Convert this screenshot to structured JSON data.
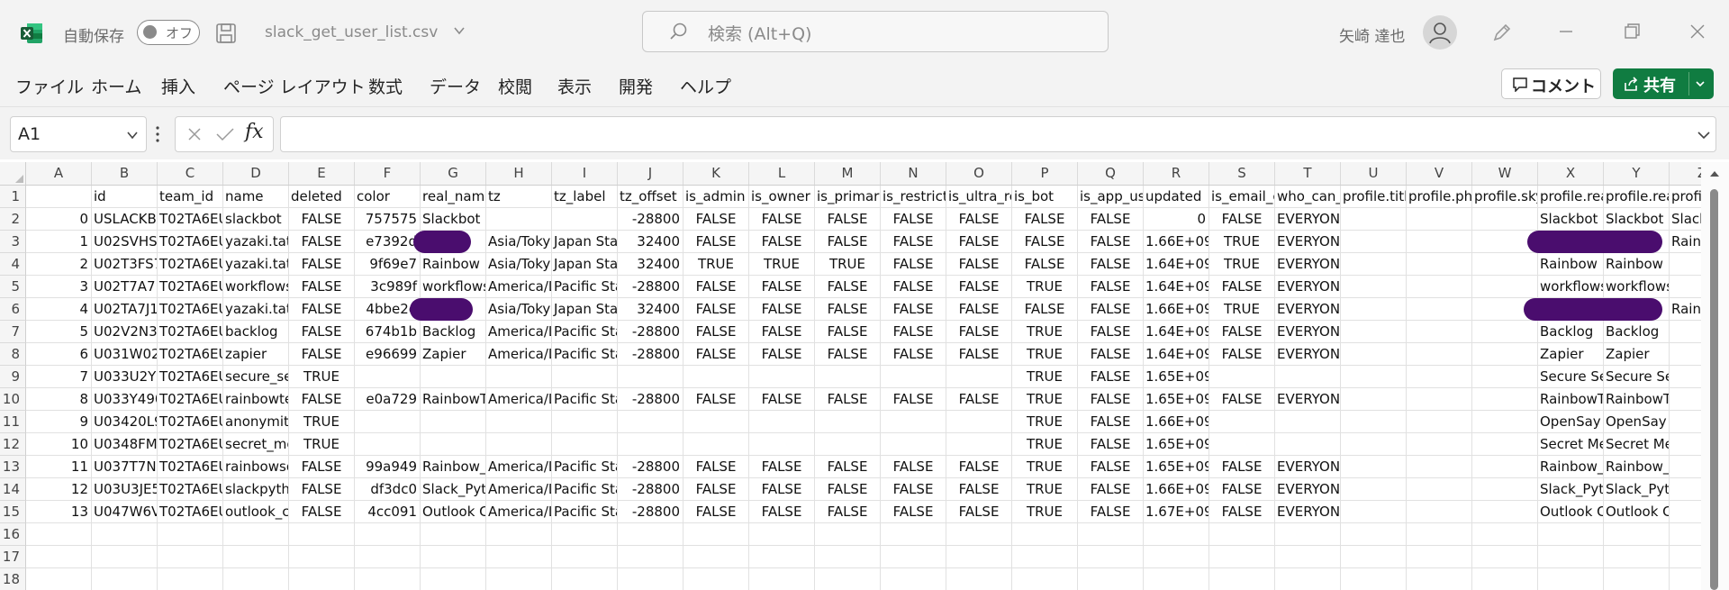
{
  "titlebar": {
    "autosave_label": "自動保存",
    "autosave_state": "オフ",
    "file_name": "slack_get_user_list.csv",
    "search_placeholder": "検索 (Alt+Q)",
    "user_name": "矢崎 達也",
    "icons": [
      "excel-logo-icon",
      "save-icon",
      "chevron-down-icon",
      "search-icon",
      "user-avatar-icon",
      "pen-icon",
      "minimize-icon",
      "restore-icon",
      "close-icon"
    ]
  },
  "menu": {
    "items": [
      "ファイル",
      "ホーム",
      "挿入",
      "ページ レイアウト",
      "数式",
      "データ",
      "校閲",
      "表示",
      "開発",
      "ヘルプ"
    ],
    "comment_label": "コメント",
    "share_label": "共有",
    "accent_color": "#107c41"
  },
  "formula_bar": {
    "cell_ref": "A1",
    "fx_label": "fx",
    "formula": ""
  },
  "grid": {
    "columns": [
      "A",
      "B",
      "C",
      "D",
      "E",
      "F",
      "G",
      "H",
      "I",
      "J",
      "K",
      "L",
      "M",
      "N",
      "O",
      "P",
      "Q",
      "R",
      "S",
      "T",
      "U",
      "V",
      "W",
      "X",
      "Y",
      "Z"
    ],
    "row_numbers": [
      "1",
      "2",
      "3",
      "4",
      "5",
      "6",
      "7",
      "8",
      "9",
      "10",
      "11",
      "12",
      "13",
      "14",
      "15",
      "16",
      "17",
      "18"
    ],
    "rows": [
      [
        "",
        "id",
        "team_id",
        "name",
        "deleted",
        "color",
        "real_name",
        "tz",
        "tz_label",
        "tz_offset",
        "is_admin",
        "is_owner",
        "is_primary",
        "is_restricte",
        "is_ultra_re",
        "is_bot",
        "is_app_us",
        "updated",
        "is_email_c",
        "who_can_",
        "profile.title",
        "profile.pho",
        "profile.sky",
        "profile.rea",
        "profile.rea",
        "profil"
      ],
      [
        "0",
        "USLACKB",
        "T02TA6EU",
        "slackbot",
        "FALSE",
        "757575",
        "Slackbot",
        "",
        "",
        "-28800",
        "FALSE",
        "FALSE",
        "FALSE",
        "FALSE",
        "FALSE",
        "FALSE",
        "FALSE",
        "0",
        "FALSE",
        "EVERYONE",
        "",
        "",
        "",
        "Slackbot",
        "Slackbot",
        "Slack"
      ],
      [
        "1",
        "U02SVHS",
        "T02TA6EU",
        "yazaki.tats",
        "FALSE",
        "e7392d",
        "",
        "Asia/Toky",
        "Japan Star",
        "32400",
        "FALSE",
        "FALSE",
        "FALSE",
        "FALSE",
        "FALSE",
        "FALSE",
        "FALSE",
        "1.66E+09",
        "TRUE",
        "EVERYONE",
        "",
        "",
        "",
        "",
        "",
        "Raini"
      ],
      [
        "2",
        "U02T3FS7",
        "T02TA6EU",
        "yazaki.tats",
        "FALSE",
        "9f69e7",
        "Rainbow P",
        "Asia/Toky",
        "Japan Star",
        "32400",
        "TRUE",
        "TRUE",
        "TRUE",
        "FALSE",
        "FALSE",
        "FALSE",
        "FALSE",
        "1.64E+09",
        "TRUE",
        "EVERYONE",
        "",
        "",
        "",
        "Rainbow P",
        "Rainbow Planet",
        "",
        ""
      ],
      [
        "3",
        "U02T7A7L",
        "T02TA6EU",
        "workflows",
        "FALSE",
        "3c989f",
        "workflows",
        "America/L",
        "Pacific Sta",
        "-28800",
        "FALSE",
        "FALSE",
        "FALSE",
        "FALSE",
        "FALSE",
        "TRUE",
        "FALSE",
        "1.64E+09",
        "FALSE",
        "EVERYONE",
        "",
        "",
        "",
        "workflows",
        "workflows",
        ""
      ],
      [
        "4",
        "U02TA7J1",
        "T02TA6EU",
        "yazaki.tats",
        "FALSE",
        "4bbe2e",
        "",
        "Asia/Toky",
        "Japan Star",
        "32400",
        "FALSE",
        "FALSE",
        "FALSE",
        "FALSE",
        "FALSE",
        "FALSE",
        "FALSE",
        "1.66E+09",
        "TRUE",
        "EVERYONE",
        "",
        "",
        "",
        "",
        "",
        "Raini"
      ],
      [
        "5",
        "U02V2N3E",
        "T02TA6EU",
        "backlog",
        "FALSE",
        "674b1b",
        "Backlog",
        "America/L",
        "Pacific Sta",
        "-28800",
        "FALSE",
        "FALSE",
        "FALSE",
        "FALSE",
        "FALSE",
        "TRUE",
        "FALSE",
        "1.64E+09",
        "FALSE",
        "EVERYONE",
        "",
        "",
        "",
        "Backlog",
        "Backlog",
        ""
      ],
      [
        "6",
        "U031W02F",
        "T02TA6EU",
        "zapier",
        "FALSE",
        "e96699",
        "Zapier",
        "America/L",
        "Pacific Sta",
        "-28800",
        "FALSE",
        "FALSE",
        "FALSE",
        "FALSE",
        "FALSE",
        "TRUE",
        "FALSE",
        "1.64E+09",
        "FALSE",
        "EVERYONE",
        "",
        "",
        "",
        "Zapier",
        "Zapier",
        ""
      ],
      [
        "7",
        "U033U2YN",
        "T02TA6EU",
        "secure_se",
        "TRUE",
        "",
        "",
        "",
        "",
        "",
        "",
        "",
        "",
        "",
        "",
        "TRUE",
        "FALSE",
        "1.65E+09",
        "",
        "",
        "",
        "",
        "",
        "Secure Ser",
        "Secure Send",
        ""
      ],
      [
        "8",
        "U033Y490",
        "T02TA6EU",
        "rainbowte",
        "FALSE",
        "e0a729",
        "RainbowT",
        "America/L",
        "Pacific Sta",
        "-28800",
        "FALSE",
        "FALSE",
        "FALSE",
        "FALSE",
        "FALSE",
        "TRUE",
        "FALSE",
        "1.65E+09",
        "FALSE",
        "EVERYONE",
        "",
        "",
        "",
        "RainbowT",
        "RainbowTest Bot",
        ""
      ],
      [
        "9",
        "U03420L9",
        "T02TA6EU",
        "anonymity",
        "TRUE",
        "",
        "",
        "",
        "",
        "",
        "",
        "",
        "",
        "",
        "",
        "TRUE",
        "FALSE",
        "1.66E+09",
        "",
        "",
        "",
        "",
        "",
        "OpenSay",
        "OpenSay",
        ""
      ],
      [
        "10",
        "U0348FM1",
        "T02TA6EU",
        "secret_me",
        "TRUE",
        "",
        "",
        "",
        "",
        "",
        "",
        "",
        "",
        "",
        "",
        "TRUE",
        "FALSE",
        "1.65E+09",
        "",
        "",
        "",
        "",
        "",
        "Secret Me",
        "Secret Message",
        ""
      ],
      [
        "11",
        "U037T7ND",
        "T02TA6EU",
        "rainbowso",
        "FALSE",
        "99a949",
        "Rainbow_S",
        "America/L",
        "Pacific Sta",
        "-28800",
        "FALSE",
        "FALSE",
        "FALSE",
        "FALSE",
        "FALSE",
        "TRUE",
        "FALSE",
        "1.65E+09",
        "FALSE",
        "EVERYONE",
        "",
        "",
        "",
        "Rainbow_S",
        "Rainbow_Socke",
        ""
      ],
      [
        "12",
        "U03U3JE5",
        "T02TA6EU",
        "slackpytho",
        "FALSE",
        "df3dc0",
        "Slack_Pyth",
        "America/L",
        "Pacific Sta",
        "-28800",
        "FALSE",
        "FALSE",
        "FALSE",
        "FALSE",
        "FALSE",
        "TRUE",
        "FALSE",
        "1.66E+09",
        "FALSE",
        "EVERYONE",
        "",
        "",
        "",
        "Slack_Pyth",
        "Slack_Python_P",
        ""
      ],
      [
        "13",
        "U047W6V4",
        "T02TA6EU",
        "outlook_ca",
        "FALSE",
        "4cc091",
        "Outlook Ca",
        "America/L",
        "Pacific Sta",
        "-28800",
        "FALSE",
        "FALSE",
        "FALSE",
        "FALSE",
        "FALSE",
        "TRUE",
        "FALSE",
        "1.67E+09",
        "FALSE",
        "EVERYONE",
        "",
        "",
        "",
        "Outlook Ca",
        "Outlook Calend",
        ""
      ],
      [
        "",
        "",
        "",
        "",
        "",
        "",
        "",
        "",
        "",
        "",
        "",
        "",
        "",
        "",
        "",
        "",
        "",
        "",
        "",
        "",
        "",
        "",
        "",
        "",
        "",
        ""
      ],
      [
        "",
        "",
        "",
        "",
        "",
        "",
        "",
        "",
        "",
        "",
        "",
        "",
        "",
        "",
        "",
        "",
        "",
        "",
        "",
        "",
        "",
        "",
        "",
        "",
        "",
        ""
      ],
      [
        "",
        "",
        "",
        "",
        "",
        "",
        "",
        "",
        "",
        "",
        "",
        "",
        "",
        "",
        "",
        "",
        "",
        "",
        "",
        "",
        "",
        "",
        "",
        "",
        "",
        ""
      ]
    ],
    "redaction_color": "#4a0d6e"
  }
}
